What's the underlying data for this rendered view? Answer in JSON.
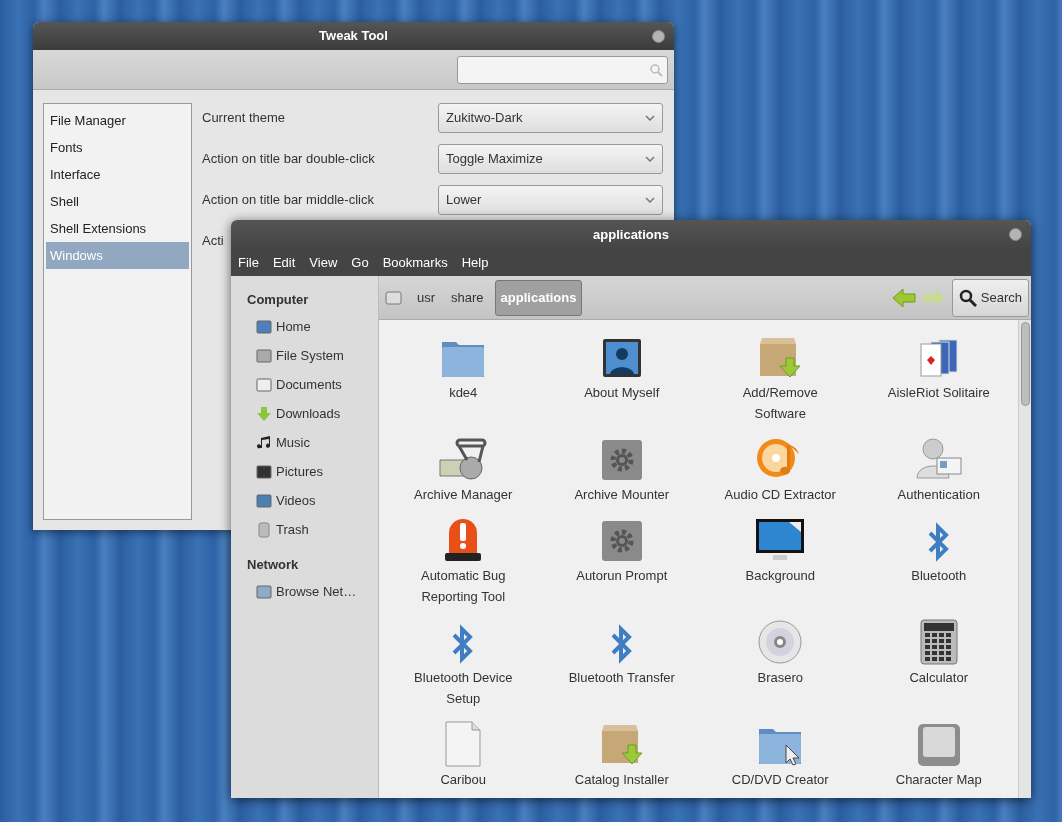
{
  "tweak_window": {
    "title": "Tweak Tool",
    "sections": [
      {
        "label": "File Manager",
        "selected": false
      },
      {
        "label": "Fonts",
        "selected": false
      },
      {
        "label": "Interface",
        "selected": false
      },
      {
        "label": "Shell",
        "selected": false
      },
      {
        "label": "Shell Extensions",
        "selected": false
      },
      {
        "label": "Windows",
        "selected": true
      }
    ],
    "settings": [
      {
        "label": "Current theme",
        "value": "Zukitwo-Dark"
      },
      {
        "label": "Action on title bar double-click",
        "value": "Toggle Maximize"
      },
      {
        "label": "Action on title bar middle-click",
        "value": "Lower"
      },
      {
        "label": "Acti"
      }
    ]
  },
  "files_window": {
    "title": "applications",
    "menu": [
      "File",
      "Edit",
      "View",
      "Go",
      "Bookmarks",
      "Help"
    ],
    "sidebar": [
      {
        "heading": "Computer",
        "items": [
          {
            "label": "Home"
          },
          {
            "label": "File System"
          },
          {
            "label": "Documents"
          },
          {
            "label": "Downloads"
          },
          {
            "label": "Music"
          },
          {
            "label": "Pictures"
          },
          {
            "label": "Videos"
          },
          {
            "label": "Trash"
          }
        ]
      },
      {
        "heading": "Network",
        "items": [
          {
            "label": "Browse Net…"
          }
        ]
      }
    ],
    "path": [
      {
        "label": "usr",
        "selected": false
      },
      {
        "label": "share",
        "selected": false
      },
      {
        "label": "applications",
        "selected": true
      }
    ],
    "search_button": "Search",
    "items": [
      {
        "label": "kde4"
      },
      {
        "label": "About Myself"
      },
      {
        "label": "Add/Remove Software"
      },
      {
        "label": "AisleRiot Solitaire"
      },
      {
        "label": "Archive Manager"
      },
      {
        "label": "Archive Mounter"
      },
      {
        "label": "Audio CD Extractor"
      },
      {
        "label": "Authentication"
      },
      {
        "label": "Automatic Bug Reporting Tool"
      },
      {
        "label": "Autorun Prompt"
      },
      {
        "label": "Background"
      },
      {
        "label": "Bluetooth"
      },
      {
        "label": "Bluetooth Device Setup"
      },
      {
        "label": "Bluetooth Transfer"
      },
      {
        "label": "Brasero"
      },
      {
        "label": "Calculator"
      },
      {
        "label": "Caribou"
      },
      {
        "label": "Catalog Installer"
      },
      {
        "label": "CD/DVD Creator"
      },
      {
        "label": "Character Map"
      }
    ]
  }
}
